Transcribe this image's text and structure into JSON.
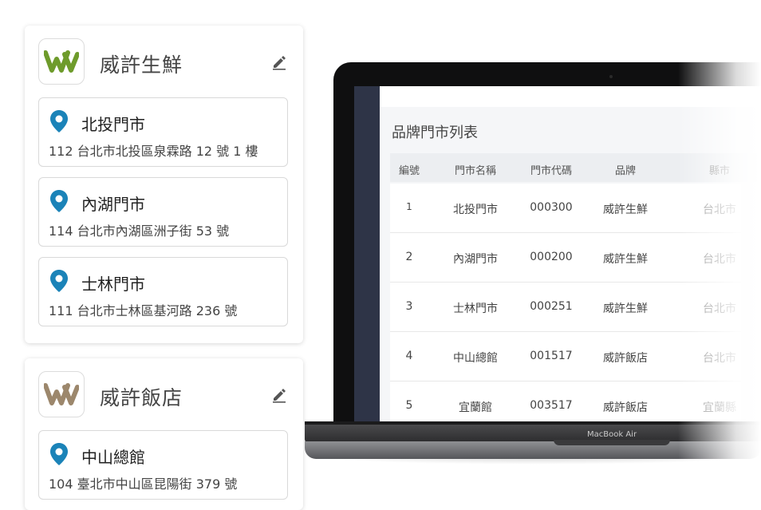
{
  "brands": [
    {
      "name": "威許生鮮",
      "logo_color": "#6e9b2b",
      "stores": [
        {
          "name": "北投門市",
          "address": "112 台北市北投區泉霖路 12 號 1 樓"
        },
        {
          "name": "內湖門市",
          "address": "114 台北市內湖區洲子街 53 號"
        },
        {
          "name": "士林門市",
          "address": "111 台北市士林區基河路 236 號"
        }
      ]
    },
    {
      "name": "威許飯店",
      "logo_color": "#9c876c",
      "stores": [
        {
          "name": "中山總館",
          "address": "104 臺北市中山區昆陽街 379 號"
        }
      ]
    }
  ],
  "icons": {
    "edit": "pencil-icon",
    "pin": "location-pin-icon"
  },
  "colors": {
    "pin": "#1b83b8",
    "sidebar": "#2e3447"
  },
  "laptop": {
    "label": "MacBook Air",
    "panel_title": "品牌門市列表",
    "table": {
      "headers": [
        "編號",
        "門市名稱",
        "門市代碼",
        "品牌",
        "縣市"
      ],
      "rows": [
        {
          "id": "1",
          "name": "北投門市",
          "code": "000300",
          "brand": "威許生鮮",
          "city": "台北市"
        },
        {
          "id": "2",
          "name": "內湖門市",
          "code": "000200",
          "brand": "威許生鮮",
          "city": "台北市"
        },
        {
          "id": "3",
          "name": "士林門市",
          "code": "000251",
          "brand": "威許生鮮",
          "city": "台北市"
        },
        {
          "id": "4",
          "name": "中山總館",
          "code": "001517",
          "brand": "威許飯店",
          "city": "台北市"
        },
        {
          "id": "5",
          "name": "宜蘭館",
          "code": "003517",
          "brand": "威許飯店",
          "city": "宜蘭縣"
        }
      ]
    }
  }
}
